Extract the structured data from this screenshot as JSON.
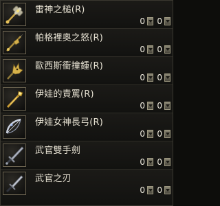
{
  "items": [
    {
      "name": "雷神之槌(R)",
      "icon": "hammer-icon",
      "qty_a": "0",
      "qty_b": "0"
    },
    {
      "name": "帕格裡奧之怒(R)",
      "icon": "lance-icon",
      "qty_a": "0",
      "qty_b": "0"
    },
    {
      "name": "歐西斯衝撞鍾(R)",
      "icon": "jackal-mace-icon",
      "qty_a": "0",
      "qty_b": "0"
    },
    {
      "name": "伊娃的責罵(R)",
      "icon": "golden-staff-icon",
      "qty_a": "0",
      "qty_b": "0"
    },
    {
      "name": "伊娃女神長弓(R)",
      "icon": "longbow-icon",
      "qty_a": "0",
      "qty_b": "0"
    },
    {
      "name": "武官雙手劍",
      "icon": "two-handed-sword-icon",
      "qty_a": "0",
      "qty_b": "0"
    },
    {
      "name": "武官之刃",
      "icon": "blade-icon",
      "qty_a": "0",
      "qty_b": "0"
    }
  ]
}
